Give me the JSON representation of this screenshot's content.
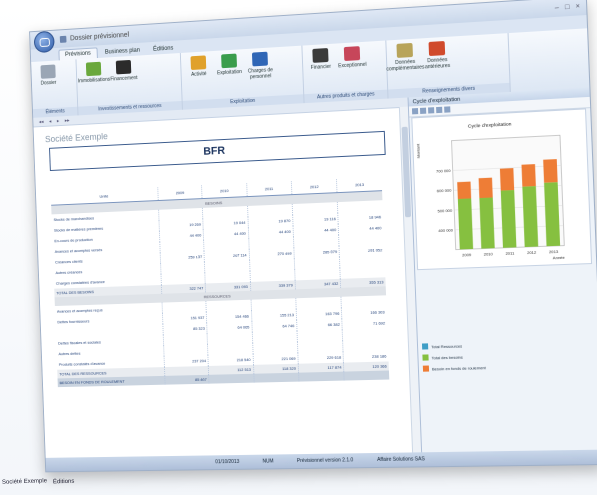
{
  "titlebar": {
    "title": "Dossier prévisionnel"
  },
  "ribbon": {
    "tabs": [
      "Prévisions",
      "Business plan",
      "Éditions"
    ],
    "groups": [
      {
        "label": "Éléments",
        "buttons": [
          {
            "label": "Dossier",
            "color": "#9aa6b5"
          }
        ]
      },
      {
        "label": "Investissements et ressources",
        "buttons": [
          {
            "label": "Immobilisations",
            "color": "#6aa83d"
          },
          {
            "label": "Financement",
            "color": "#2b2b2b"
          }
        ]
      },
      {
        "label": "Exploitation",
        "buttons": [
          {
            "label": "Activité",
            "color": "#e0a12b"
          },
          {
            "label": "Exploitation",
            "color": "#3a9d4c"
          },
          {
            "label": "Charges de personnel",
            "color": "#2f66b6"
          }
        ]
      },
      {
        "label": "Autres produits et charges",
        "buttons": [
          {
            "label": "Financier",
            "color": "#3b3b3b"
          },
          {
            "label": "Exceptionnel",
            "color": "#c7465a"
          }
        ]
      },
      {
        "label": "Renseignements divers",
        "buttons": [
          {
            "label": "Données complémentaires",
            "color": "#b8a45a"
          },
          {
            "label": "Données antérieures",
            "color": "#d04a2c"
          }
        ]
      }
    ]
  },
  "document": {
    "company": "Société Exemple",
    "title": "BFR",
    "columns": [
      "Unité",
      "2009",
      "2010",
      "2011",
      "2012",
      "2013"
    ],
    "sections": [
      {
        "name": "BESOINS",
        "rows": [
          {
            "label": "Stocks de marchandises",
            "values": [
              "",
              "",
              "",
              "",
              ""
            ]
          },
          {
            "label": "Stocks de matières premières",
            "values": [
              "19 269",
              "19 044",
              "19 870",
              "19 116",
              "18 946"
            ]
          },
          {
            "label": "En-cours de production",
            "values": [
              "44 400",
              "44 400",
              "44 400",
              "44 400",
              "44 400"
            ]
          },
          {
            "label": "Avances et acomptes versés",
            "values": [
              "",
              "",
              "",
              "",
              ""
            ]
          },
          {
            "label": "Créances clients",
            "values": [
              "259 137",
              "267 114",
              "270 499",
              "285 079",
              "291 052"
            ]
          },
          {
            "label": "Autres créances",
            "values": [
              "",
              "",
              "",
              "",
              ""
            ]
          },
          {
            "label": "Charges constatées d'avance",
            "values": [
              "",
              "",
              "",
              "",
              ""
            ]
          }
        ],
        "total": {
          "label": "TOTAL DES BESOINS",
          "values": [
            "322 747",
            "331 093",
            "339 379",
            "347 432",
            "355 313"
          ]
        }
      },
      {
        "name": "RESSOURCES",
        "rows": [
          {
            "label": "Avances et acomptes reçus",
            "values": [
              "",
              "",
              "",
              "",
              ""
            ]
          },
          {
            "label": "Dettes fournisseurs",
            "values": [
              "151 937",
              "154 466",
              "155 213",
              "163 796",
              "166 303"
            ]
          },
          {
            "label": "",
            "values": [
              "85 323",
              "64 065",
              "64 746",
              "66 382",
              "71 692"
            ]
          },
          {
            "label": "Dettes fiscales et sociales",
            "values": [
              "",
              "",
              "",
              "",
              ""
            ]
          },
          {
            "label": "Autres dettes",
            "values": [
              "",
              "",
              "",
              "",
              ""
            ]
          },
          {
            "label": "Produits constatés d'avance",
            "values": [
              "237 204",
              "218 540",
              "221 069",
              "229 618",
              "238 186"
            ]
          }
        ],
        "total": {
          "label": "TOTAL DES RESSOURCES",
          "values": [
            "",
            "112 513",
            "118 320",
            "117 874",
            "120 366"
          ]
        }
      }
    ],
    "bfr_row": {
      "label": "BESOIN EN FONDS DE ROULEMENT",
      "values": [
        "85 467",
        "",
        "",
        "",
        ""
      ]
    }
  },
  "cycle_panel": {
    "title": "Cycle d'exploitation"
  },
  "chart_data": {
    "type": "bar",
    "title": "Cycle d'exploitation",
    "ylabel": "Montant",
    "xlabel": "Année",
    "categories": [
      "2009",
      "2010",
      "2011",
      "2012",
      "2013"
    ],
    "ylim": [
      0,
      800000
    ],
    "yticks": [
      "400 000",
      "500 000",
      "600 000",
      "700 000"
    ],
    "series": [
      {
        "name": "Total Ressources",
        "color": "#3f9ec6",
        "values": [
          35000,
          35000,
          38000,
          38000,
          38000
        ]
      },
      {
        "name": "Total des besoins",
        "color": "#86c040",
        "values": [
          520000,
          520000,
          550000,
          565000,
          580000
        ]
      },
      {
        "name": "Besoin en fonds de roulement",
        "color": "#ee7d36",
        "values": [
          85000,
          100000,
          110000,
          110000,
          115000
        ]
      }
    ],
    "legend_placement": "bottom"
  },
  "statusbar": {
    "date": "01/10/2013",
    "num": "NUM",
    "version": "Prévisionnel version 2.1.0",
    "product": "Affaire Solutions SAS"
  },
  "taskbar": {
    "items": [
      "Société Exemple",
      "Éditions"
    ]
  }
}
